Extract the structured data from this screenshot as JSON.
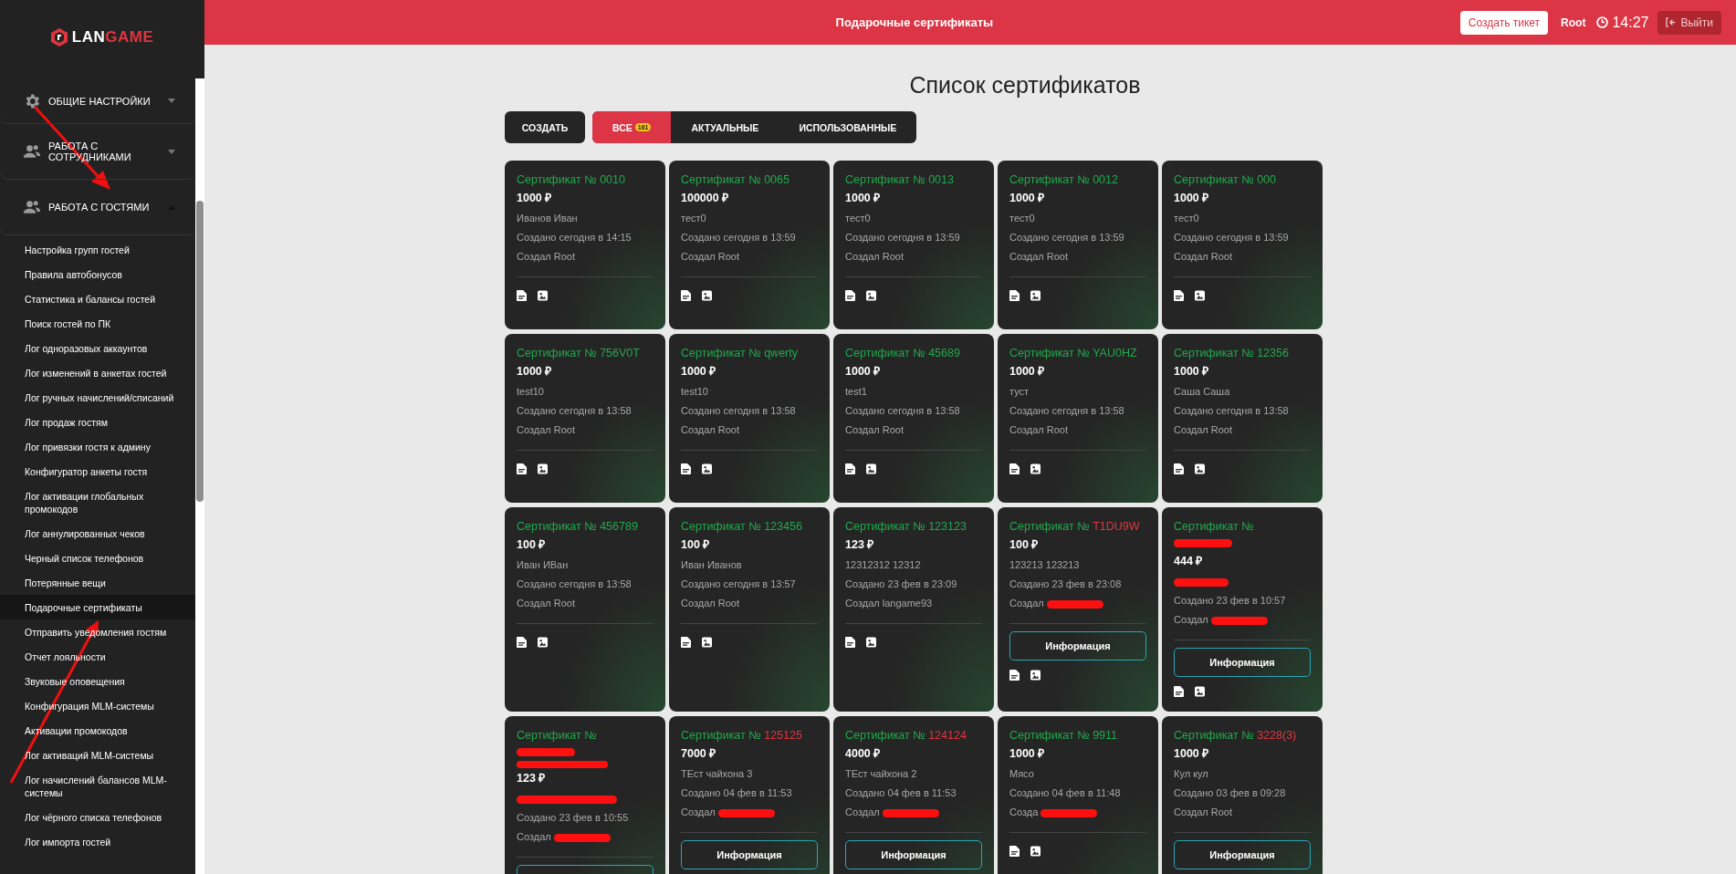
{
  "sidebar": {
    "logo": {
      "part_1": "LAN",
      "part_2": "GAME"
    },
    "sections": [
      {
        "kind": "settings",
        "label": "ОБЩИЕ НАСТРОЙКИ",
        "expanded": false
      },
      {
        "kind": "people",
        "label": "РАБОТА С СОТРУДНИКАМИ",
        "expanded": false
      },
      {
        "kind": "people",
        "label": "РАБОТА С ГОСТЯМИ",
        "expanded": true,
        "children": [
          {
            "label": "Настройка групп гостей",
            "selected": false
          },
          {
            "label": "Правила автобонусов",
            "selected": false
          },
          {
            "label": "Статистика и балансы гостей",
            "selected": false
          },
          {
            "label": "Поиск гостей по ПК",
            "selected": false
          },
          {
            "label": "Лог одноразовых аккаунтов",
            "selected": false
          },
          {
            "label": "Лог изменений в анкетах гостей",
            "selected": false
          },
          {
            "label": "Лог ручных начислений/списаний",
            "selected": false
          },
          {
            "label": "Лог продаж гостям",
            "selected": false
          },
          {
            "label": "Лог привязки гостя к админу",
            "selected": false
          },
          {
            "label": "Конфигуратор анкеты гостя",
            "selected": false
          },
          {
            "label": "Лог активации глобальных промокодов",
            "selected": false
          },
          {
            "label": "Лог аннулированных чеков",
            "selected": false
          },
          {
            "label": "Черный список телефонов",
            "selected": false
          },
          {
            "label": "Потерянные вещи",
            "selected": false
          },
          {
            "label": "Подарочные сертификаты",
            "selected": true
          },
          {
            "label": "Отправить уведомления гостям",
            "selected": false
          },
          {
            "label": "Отчет лояльности",
            "selected": false
          },
          {
            "label": "Звуковые оповещения",
            "selected": false
          },
          {
            "label": "Конфигурация MLM-системы",
            "selected": false
          },
          {
            "label": "Активации промокодов",
            "selected": false
          },
          {
            "label": "Лог активаций MLM-системы",
            "selected": false
          },
          {
            "label": "Лог начислений балансов MLM-системы",
            "selected": false
          },
          {
            "label": "Лог чёрного списка телефонов",
            "selected": false
          },
          {
            "label": "Лог импорта гостей",
            "selected": false
          }
        ]
      }
    ]
  },
  "header": {
    "title": "Подарочные сертификаты",
    "ticket_button": "Создать тикет",
    "user": "Root",
    "time": "14:27",
    "logout_button": "Выйти"
  },
  "page": {
    "title": "Список сертификатов",
    "create_button": "СОЗДАТЬ",
    "tabs": [
      {
        "label": "ВСЕ",
        "badge": "161",
        "selected": true
      },
      {
        "label": "АКТУАЛЬНЫЕ",
        "selected": false
      },
      {
        "label": "ИСПОЛЬЗОВАННЫЕ",
        "selected": false
      }
    ]
  },
  "cards": [
    {
      "label": "Сертификат №",
      "number": "0010",
      "color": "#22a94c",
      "amount": "1000 ₽",
      "guest": "Иванов Иван",
      "created": "Создано сегодня в 14:15",
      "creator": "Создал Root"
    },
    {
      "label": "Сертификат №",
      "number": "0065",
      "color": "#22a94c",
      "amount": "100000 ₽",
      "guest": "тест0",
      "created": "Создано сегодня в 13:59",
      "creator": "Создал Root"
    },
    {
      "label": "Сертификат №",
      "number": "0013",
      "color": "#22a94c",
      "amount": "1000 ₽",
      "guest": "тест0",
      "created": "Создано сегодня в 13:59",
      "creator": "Создал Root"
    },
    {
      "label": "Сертификат №",
      "number": "0012",
      "color": "#22a94c",
      "amount": "1000 ₽",
      "guest": "тест0",
      "created": "Создано сегодня в 13:59",
      "creator": "Создал Root"
    },
    {
      "label": "Сертификат №",
      "number": "000",
      "color": "#22a94c",
      "amount": "1000 ₽",
      "guest": "тест0",
      "created": "Создано сегодня в 13:59",
      "creator": "Создал Root"
    },
    {
      "label": "Сертификат №",
      "number": "756V0T",
      "color": "#22a94c",
      "amount": "1000 ₽",
      "guest": "test10",
      "created": "Создано сегодня в 13:58",
      "creator": "Создал Root"
    },
    {
      "label": "Сертификат №",
      "number": "qwerty",
      "color": "#22a94c",
      "amount": "1000 ₽",
      "guest": "test10",
      "created": "Создано сегодня в 13:58",
      "creator": "Создал Root"
    },
    {
      "label": "Сертификат №",
      "number": "45689",
      "color": "#22a94c",
      "amount": "1000 ₽",
      "guest": "test1",
      "created": "Создано сегодня в 13:58",
      "creator": "Создал Root"
    },
    {
      "label": "Сертификат №",
      "number": "YAU0HZ",
      "color": "#22a94c",
      "amount": "1000 ₽",
      "guest": "туст",
      "created": "Создано сегодня в 13:58",
      "creator": "Создал Root"
    },
    {
      "label": "Сертификат №",
      "number": "12356",
      "color": "#22a94c",
      "amount": "1000 ₽",
      "guest": "Саша Саша",
      "created": "Создано сегодня в 13:58",
      "creator": "Создал Root"
    },
    {
      "label": "Сертификат №",
      "number": "456789",
      "color": "#22a94c",
      "amount": "100 ₽",
      "guest": "Иван ИВан",
      "created": "Создано сегодня в 13:58",
      "creator": "Создал Root"
    },
    {
      "label": "Сертификат №",
      "number": "123456",
      "color": "#22a94c",
      "amount": "100 ₽",
      "guest": "Иван Иванов",
      "created": "Создано сегодня в 13:57",
      "creator": "Создал Root"
    },
    {
      "label": "Сертификат №",
      "number": "123123",
      "color": "#22a94c",
      "amount": "123 ₽",
      "guest": "12312312 12312",
      "created": "Создано 23 фев в 23:09",
      "creator": "Создал langame93"
    },
    {
      "label": "Сертификат №",
      "number": "T1DU9W",
      "color": "#e0353f",
      "amount": "100 ₽",
      "guest": "123213 123213",
      "created": "Создано 23 фев в 23:08",
      "creator": "Создал",
      "creator_hidden": true,
      "info_button": true,
      "info_label": "Информация"
    },
    {
      "label": "Сертификат №",
      "number_hidden": true,
      "amount": "444 ₽",
      "guest_hidden": true,
      "created": "Создано 23 фев в 10:57",
      "creator": "Создал",
      "creator_hidden": true,
      "info_button": true,
      "info_label": "Информация"
    },
    {
      "label": "Сертификат №",
      "number_hidden": true,
      "number_wrapped": true,
      "amount": "123 ₽",
      "guest_hidden": true,
      "created": "Создано 23 фев в 10:55",
      "creator": "Создал",
      "creator_hidden": true,
      "info_button": true
    },
    {
      "label": "Сертификат №",
      "number": "125125",
      "color": "#e0353f",
      "amount": "7000 ₽",
      "guest": "ТЕст чайхона 3",
      "created": "Создано 04 фев в 11:53",
      "creator": "Создал",
      "creator_hidden": true,
      "info_button": true,
      "info_label": "Информация"
    },
    {
      "label": "Сертификат №",
      "number": "124124",
      "color": "#e0353f",
      "amount": "4000 ₽",
      "guest": "ТЕст чайхона 2",
      "created": "Создано 04 фев в 11:53",
      "creator": "Создал",
      "creator_hidden": true,
      "info_button": true,
      "info_label": "Информация"
    },
    {
      "label": "Сертификат №",
      "number": "9911",
      "color": "#22a94c",
      "amount": "1000 ₽",
      "guest": "Мясо",
      "created": "Создано 04 фев в 11:48",
      "creator": "Созда",
      "creator_hidden": true
    },
    {
      "label": "Сертификат №",
      "number": "3228(3)",
      "color": "#e0353f",
      "amount": "1000 ₽",
      "guest": "Кул кул",
      "created": "Создано 03 фев в 09:28",
      "creator": "Создал Root",
      "info_button": true,
      "info_label": "Информация"
    }
  ]
}
